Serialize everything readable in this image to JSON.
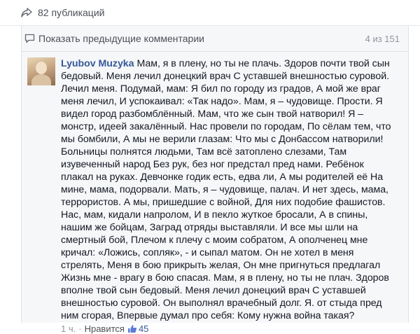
{
  "share": {
    "icon": "share-arrow-icon",
    "label": "82 публикаций"
  },
  "comments": {
    "previous": {
      "icon": "comment-bubble-icon",
      "label": "Показать предыдущие комментарии",
      "count": "4 из 151"
    },
    "item": {
      "author": "Lyubov Muzyka",
      "text": "Мам, я в плену, но ты не плачь. Здоров почти твой сын\nбедовый. Меня лечил донецкий врач С уставшей внешностью суровой.\nЛечил меня. Подумай, мам: Я бил по городу из градов, А мой же враг\nменя лечил, И успокаивал: «Так надо». Мам, я – чудовище. Прости. Я\nвидел город разбомблённый. Мам, что же сын твой натворил! Я –\nмонстр, идеей закалённый. Нас провели по городам, По сёлам тем, что\nмы бомбили, А мы не верили глазам: Что мы с Донбассом натворили!\nБольницы полнятся людьми, Там всё затоплено слезами, Там\nизувеченный народ Без рук, без ног предстал пред нами. Ребёнок\nплакал на руках. Девчонке годик есть, едва ли, А мы родителей её На\nмине, мама, подорвали. Мать, я – чудовище, палач. И нет здесь, мама,\nтеррористов. А мы, пришедшие с войной, Для них подобие фашистов.\nНас, мам, кидали напролом, И в пекло жуткое бросали, А в спины,\nнашим же бойцам, Заград отряды выставляли. И все мы шли на\nсмертный бой, Плечом к плечу с моим собратом, А ополченец мне\nкричал: «Ложись, сопляк», - и сыпал матом. Он не хотел в меня\nстрелять, Меня в бою прикрыть желая, Он мне пригнуться предлагал\nЖизнь мне - врагу в бою спасая. Мам, я в плену, но ты не плач. Здоров\nвполне твой сын бедовый. Меня лечил донецкий врач С уставшей\nвнешностью суровой. Он выполнял врачебный долг. Я. от стыда пред\nним сгорая, Впервые думал про себя: Кому нужна война такая?",
      "time": "1 ч.",
      "separator": "·",
      "like_label": "Нравится",
      "like_icon": "thumbs-up-icon",
      "likes": "45"
    }
  },
  "colors": {
    "link": "#365899",
    "meta": "#90949c",
    "panel": "#f6f7f9"
  }
}
